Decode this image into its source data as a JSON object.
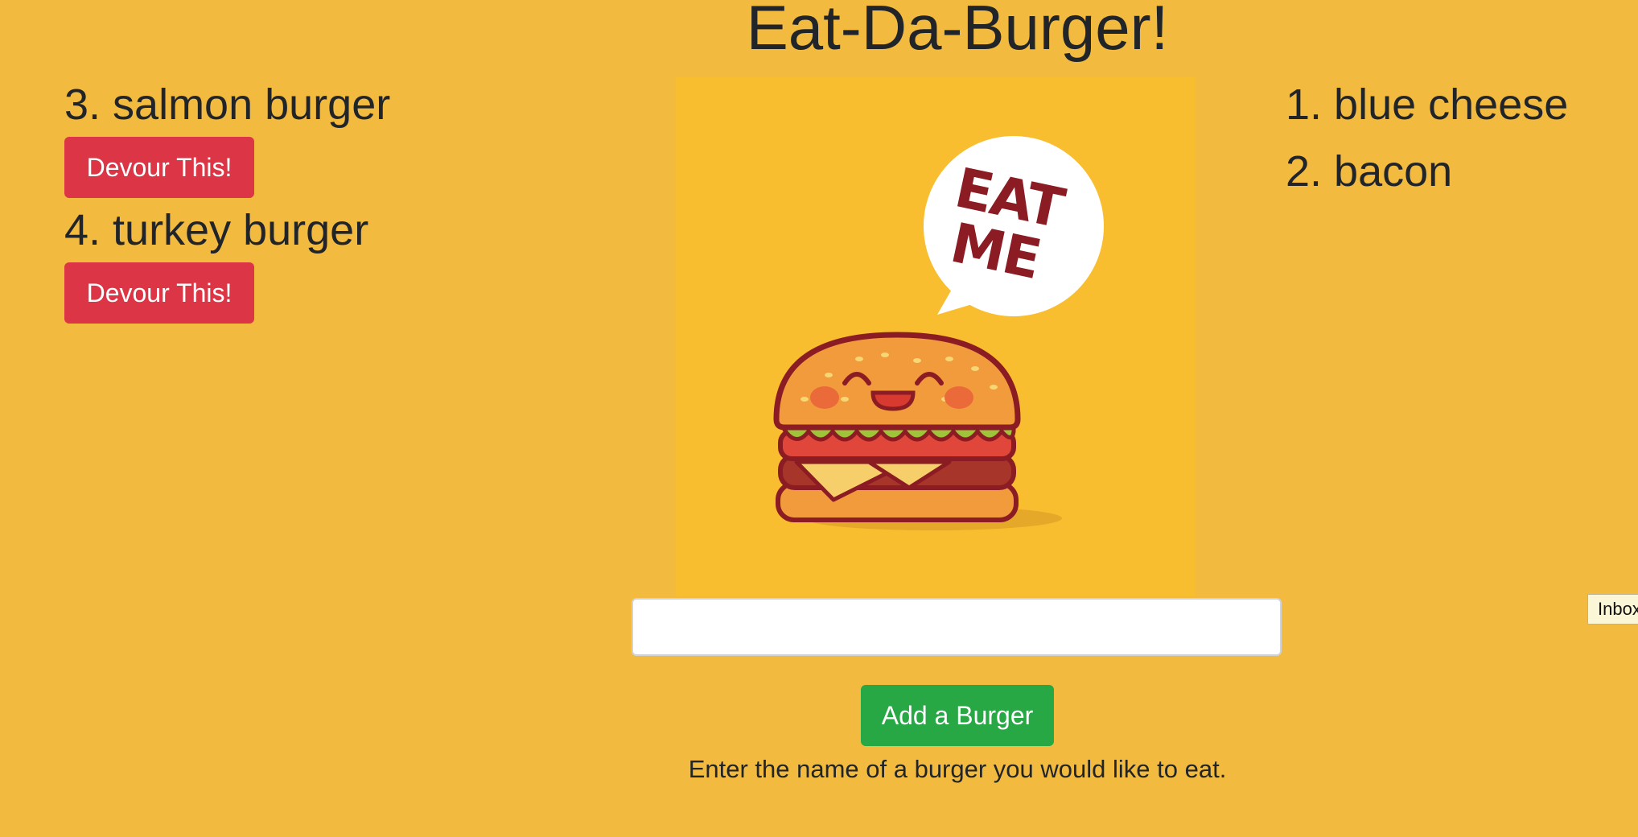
{
  "header": {
    "title": "Eat-Da-Burger!"
  },
  "available_burgers": [
    {
      "label": "3. salmon burger",
      "button_label": "Devour This!"
    },
    {
      "label": "4. turkey burger",
      "button_label": "Devour This!"
    }
  ],
  "devoured_burgers": [
    {
      "label": "1. blue cheese"
    },
    {
      "label": "2. bacon"
    }
  ],
  "hero": {
    "speech_bubble_text": "EAT ME",
    "icon": "happy-burger-illustration"
  },
  "form": {
    "input_value": "",
    "input_placeholder": "",
    "submit_label": "Add a Burger",
    "help_text": "Enter the name of a burger you would like to eat."
  },
  "tooltip": {
    "label": "Inbox"
  },
  "colors": {
    "background": "#f2bb3f",
    "devour_button": "#dc3545",
    "add_button": "#28a745",
    "hero_background": "#f9be2f"
  }
}
